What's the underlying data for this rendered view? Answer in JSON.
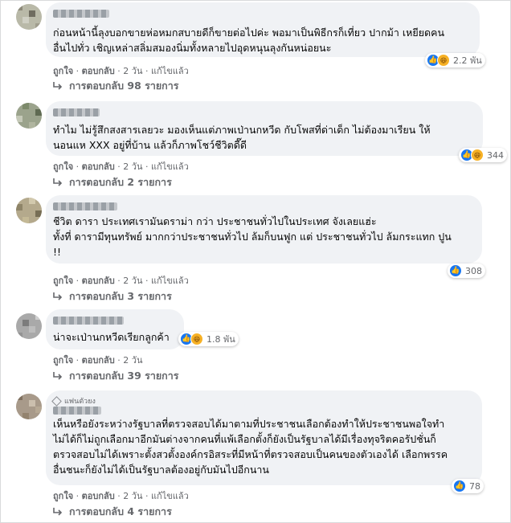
{
  "comments": [
    {
      "text_lines": [
        "ก่อนหน้านี้ลุงบอกขายห่อหมกสบายดีก็ขายต่อไปค่ะ พอมาเป็นพิธีกรก็เที่ยว ปากม้า เหยียดคน",
        "อื่นไปทั่ว เชิญเหล่าสลิ่มสมองนิ่มทั้งหลายไปอุดหนุนลุงกันหน่อยนะ"
      ],
      "reaction_icons": [
        "like-icon",
        "haha-icon"
      ],
      "reaction_count": "2.2 พัน",
      "actions": {
        "like": "ถูกใจ",
        "reply": "ตอบกลับ",
        "time": "2 วัน",
        "edited": "แก้ไขแล้ว"
      },
      "replies_label": "การตอบกลับ 98 รายการ"
    },
    {
      "text_lines": [
        "ทำไม ไม่รู้สึกสงสารเลยวะ มองเห็นแต่ภาพเป่านกหวีด กับโพสที่ด่าเด็ก ไม่ต้องมาเรียน ให้",
        "นอนแห XXX อยู่ที่บ้าน แล้วก็ภาพโชว์ชีวิตดี๊ดี"
      ],
      "reaction_icons": [
        "like-icon",
        "haha-icon"
      ],
      "reaction_count": "344",
      "actions": {
        "like": "ถูกใจ",
        "reply": "ตอบกลับ",
        "time": "2 วัน",
        "edited": "แก้ไขแล้ว"
      },
      "replies_label": "การตอบกลับ 2 รายการ"
    },
    {
      "text_lines": [
        "ชีวิต ดารา ประเทศเรามันดราม่า กว่า ประชาชนทั่วไปในประเทศ จังเลยแฮ่ะ",
        "ทั้งที่ ดารามีทุนทรัพย์ มากกว่าประชาชนทั่วไป ล้มก็บนฟูก แต่ ประชาชนทั่วไป ล้มกระแทก ปูน",
        "!!"
      ],
      "reaction_icons": [
        "like-icon"
      ],
      "reaction_count": "308",
      "actions": {
        "like": "ถูกใจ",
        "reply": "ตอบกลับ",
        "time": "2 วัน",
        "edited": "แก้ไขแล้ว"
      },
      "replies_label": "การตอบกลับ 3 รายการ"
    },
    {
      "text_lines": [
        "น่าจะเป่านกหวีดเรียกลูกค้า"
      ],
      "reaction_icons": [
        "like-icon",
        "haha-icon"
      ],
      "reaction_count": "1.8 พัน",
      "actions": {
        "like": "ถูกใจ",
        "reply": "ตอบกลับ",
        "time": "2 วัน",
        "edited": ""
      },
      "replies_label": "การตอบกลับ 39 รายการ"
    },
    {
      "fan_badge": "แฟนตัวยง",
      "text_lines": [
        "เห็นหรือยังระหว่างรัฐบาลที่ตรวจสอบได้มาตามที่ประชาชนเลือกต้องทำให้ประชาชนพอใจทำ",
        "ไม่ได้ก็ไม่ถูกเลือกมาอีกมันต่างจากคนที่แพ้เลือกตั้งก็ยังเป็นรัฐบาลได้มีเรื่องทุจริตคอรัปชั่นก็",
        "ตรวจสอบไม่ได้เพราะตั้งสวตั้งองค์กรอิสระที่มีหน้าที่ตรวจสอบเป็นคนของตัวเองได้ เลือกพรรค",
        "อื่นชนะก็ยังไม่ได้เป็นรัฐบาลต้องอยู่กับมันไปอีกนาน"
      ],
      "reaction_icons": [
        "like-icon"
      ],
      "reaction_count": "78",
      "actions": {
        "like": "ถูกใจ",
        "reply": "ตอบกลับ",
        "time": "2 วัน",
        "edited": "แก้ไขแล้ว"
      },
      "replies_label": "การตอบกลับ 4 รายการ"
    }
  ],
  "colors": {
    "bubble": "#f0f2f5",
    "meta": "#65676b",
    "like": "#1877f2",
    "haha": "#f7b125"
  }
}
